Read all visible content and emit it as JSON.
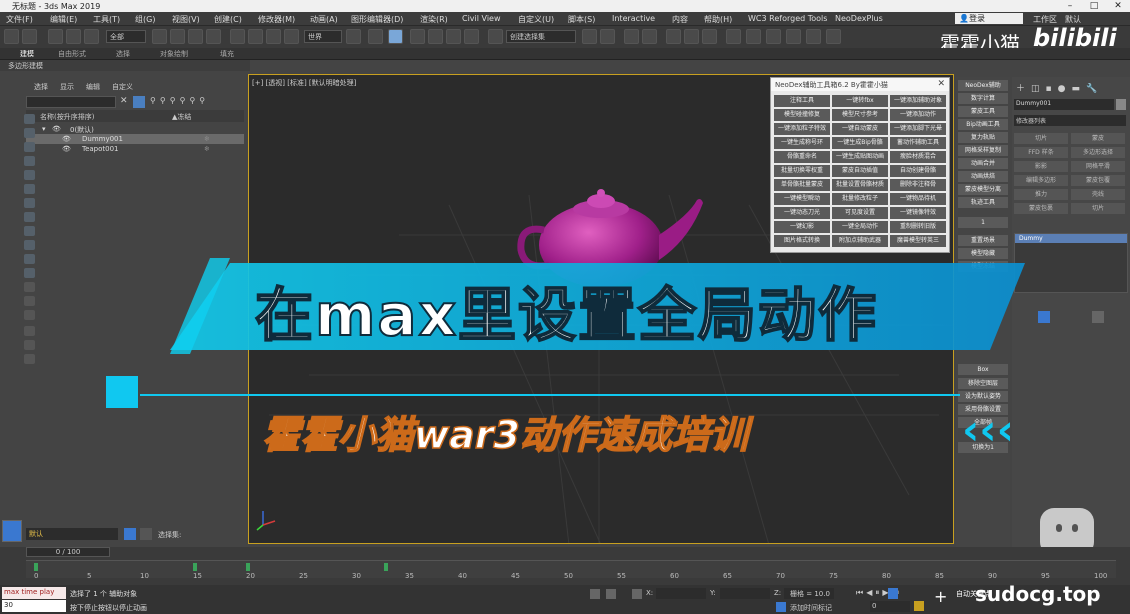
{
  "window": {
    "title": "无标题 - 3ds Max 2019"
  },
  "menu": [
    "文件(F)",
    "编辑(E)",
    "工具(T)",
    "组(G)",
    "视图(V)",
    "创建(C)",
    "修改器(M)",
    "动画(A)",
    "图形编辑器(D)",
    "渲染(R)",
    "Civil View",
    "自定义(U)",
    "脚本(S)",
    "Interactive",
    "内容",
    "帮助(H)",
    "WC3 Reforged Tools",
    "NeoDexPlus"
  ],
  "login": "登录",
  "workspace": "工作区",
  "workspace_label": "默认",
  "toolbar": {
    "filter_all": "全部",
    "coord": "世界",
    "selection_set": "创建选择集"
  },
  "ribbon_tabs": [
    "建模",
    "自由形式",
    "选择",
    "对象绘制",
    "填充"
  ],
  "ribbon_sub": "多边形建模",
  "scene_explorer": {
    "menu": [
      "选择",
      "显示",
      "编辑",
      "自定义"
    ],
    "col_name": "名称(按升序排序)",
    "col_frozen": "▲冻结",
    "rows": [
      "0(默认)",
      "Dummy001",
      "Teapot001"
    ]
  },
  "viewport": {
    "label": "[+] [透视] [标准] [默认明暗处理]"
  },
  "neodex": {
    "title": "NeoDex辅助工具箱6.2 By霍霍小猫",
    "buttons": [
      "注释工具",
      "一键转fbx",
      "一键添加辅助对象",
      "模型碰撞修复",
      "模型尺寸参考",
      "一键添加动作",
      "一键添加粒子特效",
      "一键自动蒙皮",
      "一键添加脚下光晕",
      "一键生成称号环",
      "一键生成Bip骨骼",
      "蓄动作辅助工具",
      "骨骼重命名",
      "一键生成贴图动画",
      "瘦脸材质混合",
      "批量切换零权重",
      "蒙皮自动插值",
      "自动创建骨骼",
      "单骨骼批量蒙皮",
      "批量设置骨骼材质",
      "删除非注释骨",
      "一键模型瞬动",
      "批量修改粒子",
      "一键物品待机",
      "一键动态刀光",
      "可见度设置",
      "一键镜像特效",
      "一键幻影",
      "一键全局动作",
      "重制删转旧版",
      "图片格式转换",
      "附加点辅助武器",
      "魔兽模型转英三"
    ]
  },
  "right_strip": [
    "NeoDex辅助",
    "数字计算",
    "蒙皮工具",
    "Bip动画工具",
    "复力轨贴",
    "网格采样复制",
    "动画合并",
    "动画烘焙",
    "蒙皮模型分离",
    "轨迹工具",
    "1",
    "重置场景",
    "模型隐藏",
    "模型冻结",
    "Box",
    "移除空图层",
    "设为默认姿势",
    "采用骨骼设置",
    "全部帧",
    "切换为1"
  ],
  "command_panel": {
    "object_name": "Dummy001",
    "modifier_list": "修改器列表",
    "buttons": [
      "切片",
      "蒙皮",
      "FFD 样条",
      "多边形选择",
      "影影",
      "网格平滑",
      "编辑多边形",
      "蒙皮包覆",
      "推力",
      "壳线",
      "蒙皮包裹",
      "切片"
    ],
    "dummy_list_item": "Dummy"
  },
  "banner": {
    "title": "在max里设置全局动作",
    "subtitle": "霍霍小猫war3动作速成培训"
  },
  "watermark": "霍霍小猫",
  "bilibili": "bilibili",
  "timeline": {
    "frame": "0 / 100",
    "layer": "默认",
    "selection_set": "选择集:",
    "ticks": [
      "0",
      "5",
      "10",
      "15",
      "20",
      "25",
      "30",
      "35",
      "40",
      "45",
      "50",
      "55",
      "60",
      "65",
      "70",
      "75",
      "80",
      "85",
      "90",
      "95",
      "100"
    ],
    "key_frames": [
      0,
      15,
      20,
      33
    ]
  },
  "status": {
    "line1": "选择了 1 个 辅助对象",
    "line2": "按下停止按钮以停止动画",
    "maxscript": "max time play",
    "frame_field": "30",
    "grid": "栅格 = 10.0",
    "add_tag": "添加时间标记",
    "autokey": "自动关键点",
    "x_label": "X:",
    "y_label": "Y:",
    "z_label": "Z:"
  },
  "site": "sudocg.top"
}
